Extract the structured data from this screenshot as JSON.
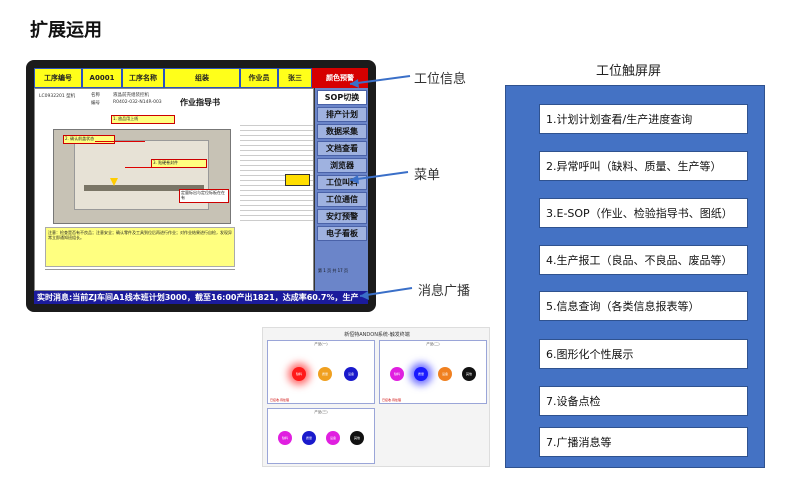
{
  "page_title": "扩展运用",
  "tablet": {
    "topbar": {
      "station_no_label": "工序编号",
      "station_no": "A0001",
      "station_name_label": "工序名称",
      "station_name": "组装",
      "operator_label": "作业员",
      "operator": "张三",
      "alert": "颜色预警"
    },
    "doc": {
      "title": "作业指导书",
      "model": "LC0932201 型机",
      "name_label": "名称",
      "name_value": "液晶前壳组装控机",
      "code_label": "编号",
      "code_value": "R0402-032-N14R-003",
      "notes": [
        "1. 放品用上线",
        "2. 确认前盖状态",
        "3. 贴硬卷封件",
        "定量标出与定位标板在在有"
      ],
      "remark": "注意：检查是否有不良品；注意安全；确认零件及工具到位后再进行作业；对作业结果进行自检，发现异常立即通知班组长。"
    },
    "menu": [
      {
        "label": "SOP切换",
        "active": true
      },
      {
        "label": "排产计划",
        "active": false
      },
      {
        "label": "数据采集",
        "active": false
      },
      {
        "label": "文档查看",
        "active": false
      },
      {
        "label": "浏览器",
        "active": false
      },
      {
        "label": "工位叫料",
        "active": false
      },
      {
        "label": "工位通信",
        "active": false
      },
      {
        "label": "安灯预警",
        "active": false
      },
      {
        "label": "电子看板",
        "active": false
      }
    ],
    "menu_info": "第 1 页 共 17 页",
    "ticker": "实时消息:当前ZJ车间A1线本班计划3000，截至16:00产出1821，达成率60.7%，生产"
  },
  "callouts": {
    "station_info": "工位信息",
    "menu": "菜单",
    "broadcast": "消息广播"
  },
  "andon": {
    "title": "新恒特ANDON系统-触发终端",
    "panels": [
      {
        "head": "产品(一)",
        "foot": "已接收·待处理"
      },
      {
        "head": "产品(二)",
        "foot": "已接收·待处理"
      },
      {
        "head": "产品(三)",
        "foot": ""
      }
    ],
    "dots": [
      {
        "label": "缺料",
        "color": "#ff1a1a"
      },
      {
        "label": "质量",
        "color": "#f0a020"
      },
      {
        "label": "设备",
        "color": "#1a1acc"
      },
      {
        "label": "缺料",
        "color": "#e01fe0"
      },
      {
        "label": "质量",
        "color": "#1a1aff"
      },
      {
        "label": "设备",
        "color": "#f08020"
      },
      {
        "label": "其他",
        "color": "#111111"
      },
      {
        "label": "缺料",
        "color": "#e01fe0"
      },
      {
        "label": "质量",
        "color": "#1a1acc"
      },
      {
        "label": "设备",
        "color": "#e01fe0"
      },
      {
        "label": "其他",
        "color": "#111111"
      }
    ]
  },
  "right_panel": {
    "title": "工位触屏屏",
    "items": [
      "1.计划计划查看/生产进度查询",
      "2.异常呼叫（缺料、质量、生产等）",
      "3.E-SOP（作业、检验指导书、图纸）",
      "4.生产报工（良品、不良品、废品等）",
      "5.信息查询（各类信息报表等）",
      "6.图形化个性展示",
      "7.设备点检",
      "7.广播消息等"
    ]
  }
}
